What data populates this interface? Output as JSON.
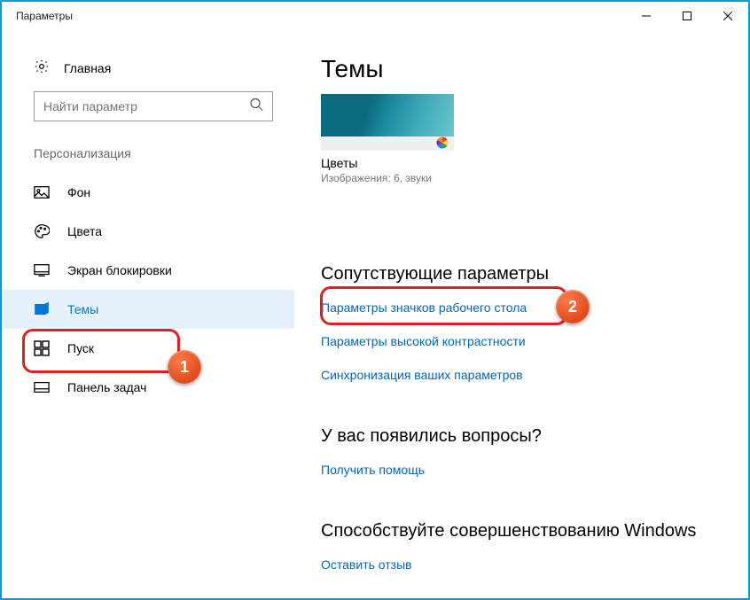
{
  "window": {
    "title": "Параметры"
  },
  "sidebar": {
    "home": "Главная",
    "search_placeholder": "Найти параметр",
    "section": "Персонализация",
    "items": [
      {
        "label": "Фон"
      },
      {
        "label": "Цвета"
      },
      {
        "label": "Экран блокировки"
      },
      {
        "label": "Темы"
      },
      {
        "label": "Пуск"
      },
      {
        "label": "Панель задач"
      }
    ]
  },
  "main": {
    "heading": "Темы",
    "theme": {
      "name": "Цветы",
      "meta": "Изображения: 6, звуки"
    },
    "related": {
      "heading": "Сопутствующие параметры",
      "links": [
        "Параметры значков рабочего стола",
        "Параметры высокой контрастности",
        "Синхронизация ваших параметров"
      ]
    },
    "help": {
      "heading": "У вас появились вопросы?",
      "link": "Получить помощь"
    },
    "feedback": {
      "heading": "Способствуйте совершенствованию Windows",
      "link": "Оставить отзыв"
    }
  },
  "annotations": {
    "badge1": "1",
    "badge2": "2"
  }
}
